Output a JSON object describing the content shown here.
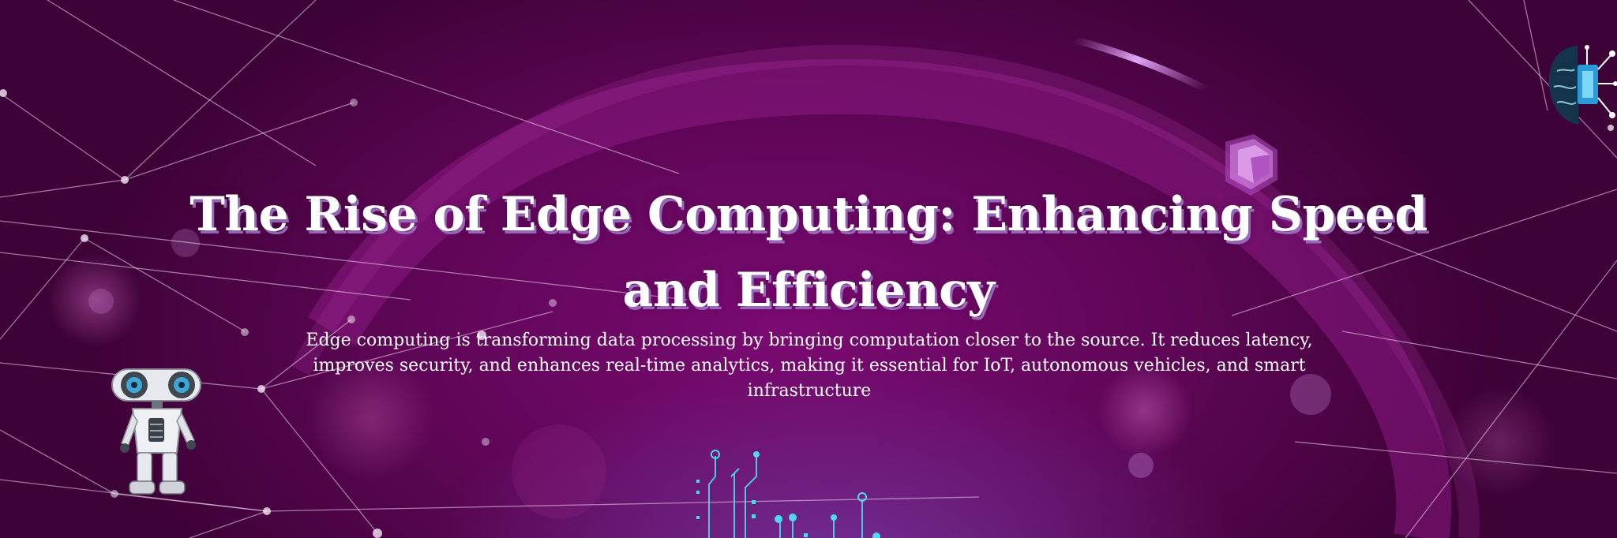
{
  "hero": {
    "title": "The Rise of Edge Computing: Enhancing Speed and Efficiency",
    "description": "Edge computing is transforming data processing by bringing computation closer to the source. It reduces latency, improves security, and enhances real-time analytics, making it essential for IoT, autonomous vehicles, and smart infrastructure"
  },
  "theme": {
    "background": "#5e0656",
    "accent_glow": "#7a0a72",
    "circuit_color": "#4fd8f0",
    "text_color": "#ffffff"
  },
  "decorations": {
    "illustrations": [
      "robot-illustration",
      "brain-chip-illustration",
      "cube-icon",
      "circuit-illustration",
      "network-lines"
    ]
  }
}
